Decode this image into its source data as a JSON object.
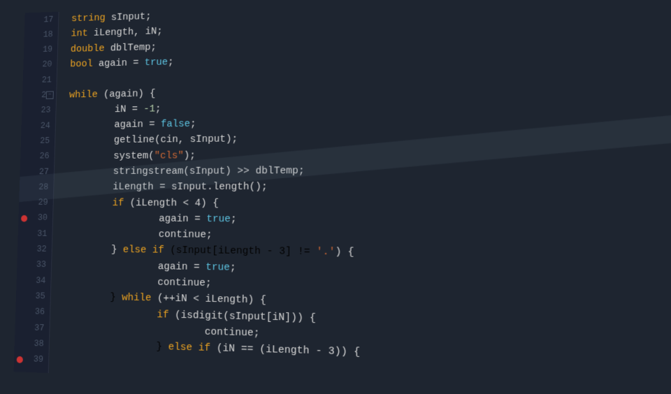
{
  "editor": {
    "background": "#1e2530",
    "gutter_bg": "#1a2030",
    "lines": [
      {
        "num": 17,
        "tokens": [
          {
            "t": "string",
            "c": "kw"
          },
          {
            "t": " sInput;",
            "c": "plain"
          }
        ]
      },
      {
        "num": 18,
        "tokens": [
          {
            "t": "int",
            "c": "kw"
          },
          {
            "t": " iLength, iN;",
            "c": "plain"
          }
        ]
      },
      {
        "num": 19,
        "tokens": [
          {
            "t": "double",
            "c": "kw"
          },
          {
            "t": " dblTemp;",
            "c": "plain"
          }
        ]
      },
      {
        "num": 20,
        "tokens": [
          {
            "t": "bool",
            "c": "kw"
          },
          {
            "t": " again = ",
            "c": "plain"
          },
          {
            "t": "true",
            "c": "bool-val"
          },
          {
            "t": ";",
            "c": "plain"
          }
        ]
      },
      {
        "num": 21,
        "tokens": []
      },
      {
        "num": 22,
        "tokens": [
          {
            "t": "while",
            "c": "kw"
          },
          {
            "t": " (again) {",
            "c": "plain"
          }
        ],
        "fold": true
      },
      {
        "num": 23,
        "tokens": [
          {
            "t": "        iN = ",
            "c": "plain"
          },
          {
            "t": "-1",
            "c": "num"
          },
          {
            "t": ";",
            "c": "plain"
          }
        ]
      },
      {
        "num": 24,
        "tokens": [
          {
            "t": "        again = ",
            "c": "plain"
          },
          {
            "t": "false",
            "c": "bool-val"
          },
          {
            "t": ";",
            "c": "plain"
          }
        ]
      },
      {
        "num": 25,
        "tokens": [
          {
            "t": "        getline(cin, sInput);",
            "c": "plain"
          }
        ]
      },
      {
        "num": 26,
        "tokens": [
          {
            "t": "        system(",
            "c": "plain"
          },
          {
            "t": "\"cls\"",
            "c": "str"
          },
          {
            "t": ");",
            "c": "plain"
          }
        ]
      },
      {
        "num": 27,
        "tokens": [
          {
            "t": "        stringstream(sInput) >> dblTemp;",
            "c": "plain"
          }
        ]
      },
      {
        "num": 28,
        "tokens": [
          {
            "t": "        iLength = sInput.length();",
            "c": "plain"
          }
        ]
      },
      {
        "num": 29,
        "tokens": [
          {
            "t": "        "
          },
          {
            "t": "if",
            "c": "kw"
          },
          {
            "t": " (iLength < 4) {",
            "c": "plain"
          }
        ]
      },
      {
        "num": 30,
        "tokens": [
          {
            "t": "                again = ",
            "c": "plain"
          },
          {
            "t": "true",
            "c": "bool-val"
          },
          {
            "t": ";",
            "c": "plain"
          }
        ],
        "breakpoint": true
      },
      {
        "num": 31,
        "tokens": [
          {
            "t": "                continue;",
            "c": "plain"
          }
        ]
      },
      {
        "num": 32,
        "tokens": [
          {
            "t": "        } ",
            "c": "plain"
          },
          {
            "t": "else if",
            "c": "kw"
          },
          {
            "t": " (sInput[iLength - 3] != "
          },
          {
            "t": "'.'",
            "c": "str"
          },
          {
            "t": ") {",
            "c": "plain"
          }
        ]
      },
      {
        "num": 33,
        "tokens": [
          {
            "t": "                again = ",
            "c": "plain"
          },
          {
            "t": "true",
            "c": "bool-val"
          },
          {
            "t": ";",
            "c": "plain"
          }
        ]
      },
      {
        "num": 34,
        "tokens": [
          {
            "t": "                continue;",
            "c": "plain"
          }
        ]
      },
      {
        "num": 35,
        "tokens": [
          {
            "t": "        } "
          },
          {
            "t": "while",
            "c": "kw"
          },
          {
            "t": " (++iN < iLength) {",
            "c": "plain"
          }
        ]
      },
      {
        "num": 36,
        "tokens": [
          {
            "t": "                "
          },
          {
            "t": "if",
            "c": "kw"
          },
          {
            "t": " (isdigit(sInput[iN])) {",
            "c": "plain"
          }
        ]
      },
      {
        "num": 37,
        "tokens": [
          {
            "t": "                        continue;",
            "c": "plain"
          }
        ]
      },
      {
        "num": 38,
        "tokens": [
          {
            "t": "                } "
          },
          {
            "t": "else if",
            "c": "kw"
          },
          {
            "t": " (iN == (iLength - 3)) {",
            "c": "plain"
          }
        ]
      },
      {
        "num": 39,
        "tokens": [
          {
            "t": "                        "
          }
        ]
      }
    ]
  }
}
